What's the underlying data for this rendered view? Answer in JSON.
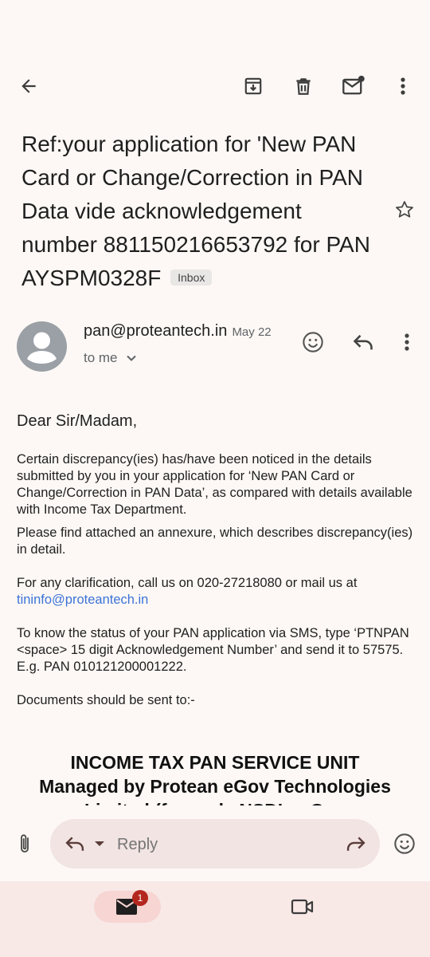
{
  "toolbar": {
    "back": "back-arrow-icon",
    "archive": "archive-icon",
    "delete": "delete-icon",
    "mark_unread": "mark-unread-icon",
    "more": "more-vert-icon"
  },
  "email": {
    "subject": "Ref:your application for 'New PAN Card or Change/Correction in PAN Data vide acknowledgement number 881150216653792 for PAN AYSPM0328F",
    "label": "Inbox",
    "sender": "pan@proteantech.in",
    "date": "May 22",
    "to": "to me",
    "greeting": "Dear Sir/Madam,",
    "para1": "Certain discrepancy(ies) has/have been noticed in the details submitted by you in your application for ‘New PAN Card or Change/Correction in PAN Data’, as compared with details available with Income Tax Department.",
    "para2": "Please find attached an annexure, which describes discrepancy(ies) in detail.",
    "para3_prefix": "For any clarification, call us on 020-27218080 or mail us at",
    "para3_link": "tininfo@proteantech.in",
    "para4_line1": "To know the status of your PAN application via SMS, type ‘PTNPAN <space> 15 digit Acknowledgement Number’ and send it to 57575.",
    "para4_line2": "E.g. PAN 010121200001222.",
    "para5": "Documents should be sent to:-",
    "bold_line1": "INCOME TAX PAN SERVICE UNIT",
    "bold_line2": "Managed by Protean eGov Technologies",
    "bold_line3": "Limited (formerly NSDL e-Gov"
  },
  "reply": {
    "placeholder": "Reply"
  },
  "nav": {
    "mail_badge": "1"
  },
  "colors": {
    "background": "#fdf8f5",
    "link": "#3c73d8",
    "nav_bg": "#f8e9e7",
    "badge_red": "#b3261e"
  }
}
